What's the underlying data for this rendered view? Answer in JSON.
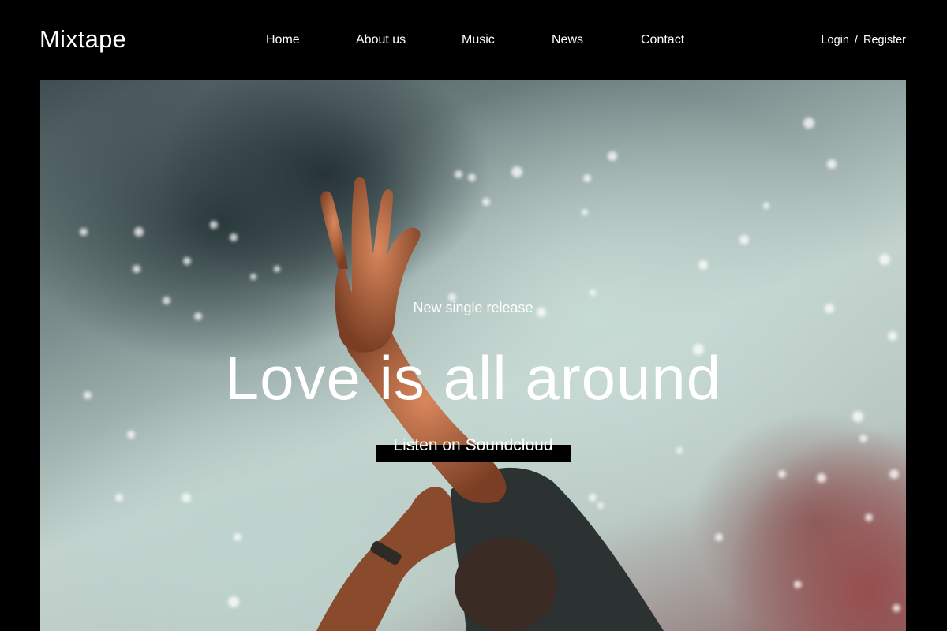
{
  "brand": {
    "name": "Mixtape"
  },
  "nav": {
    "items": [
      {
        "label": "Home",
        "active": true
      },
      {
        "label": "About us",
        "active": false
      },
      {
        "label": "Music",
        "active": false
      },
      {
        "label": "News",
        "active": false
      },
      {
        "label": "Contact",
        "active": false
      }
    ]
  },
  "auth": {
    "login": "Login",
    "separator": "/",
    "register": "Register"
  },
  "hero": {
    "subtitle": "New single release",
    "title": "Love is all around",
    "cta_label": "Listen on Soundcloud"
  },
  "colors": {
    "background": "#000000",
    "active_nav_bg": "#5d5d5d",
    "text": "#ffffff"
  }
}
